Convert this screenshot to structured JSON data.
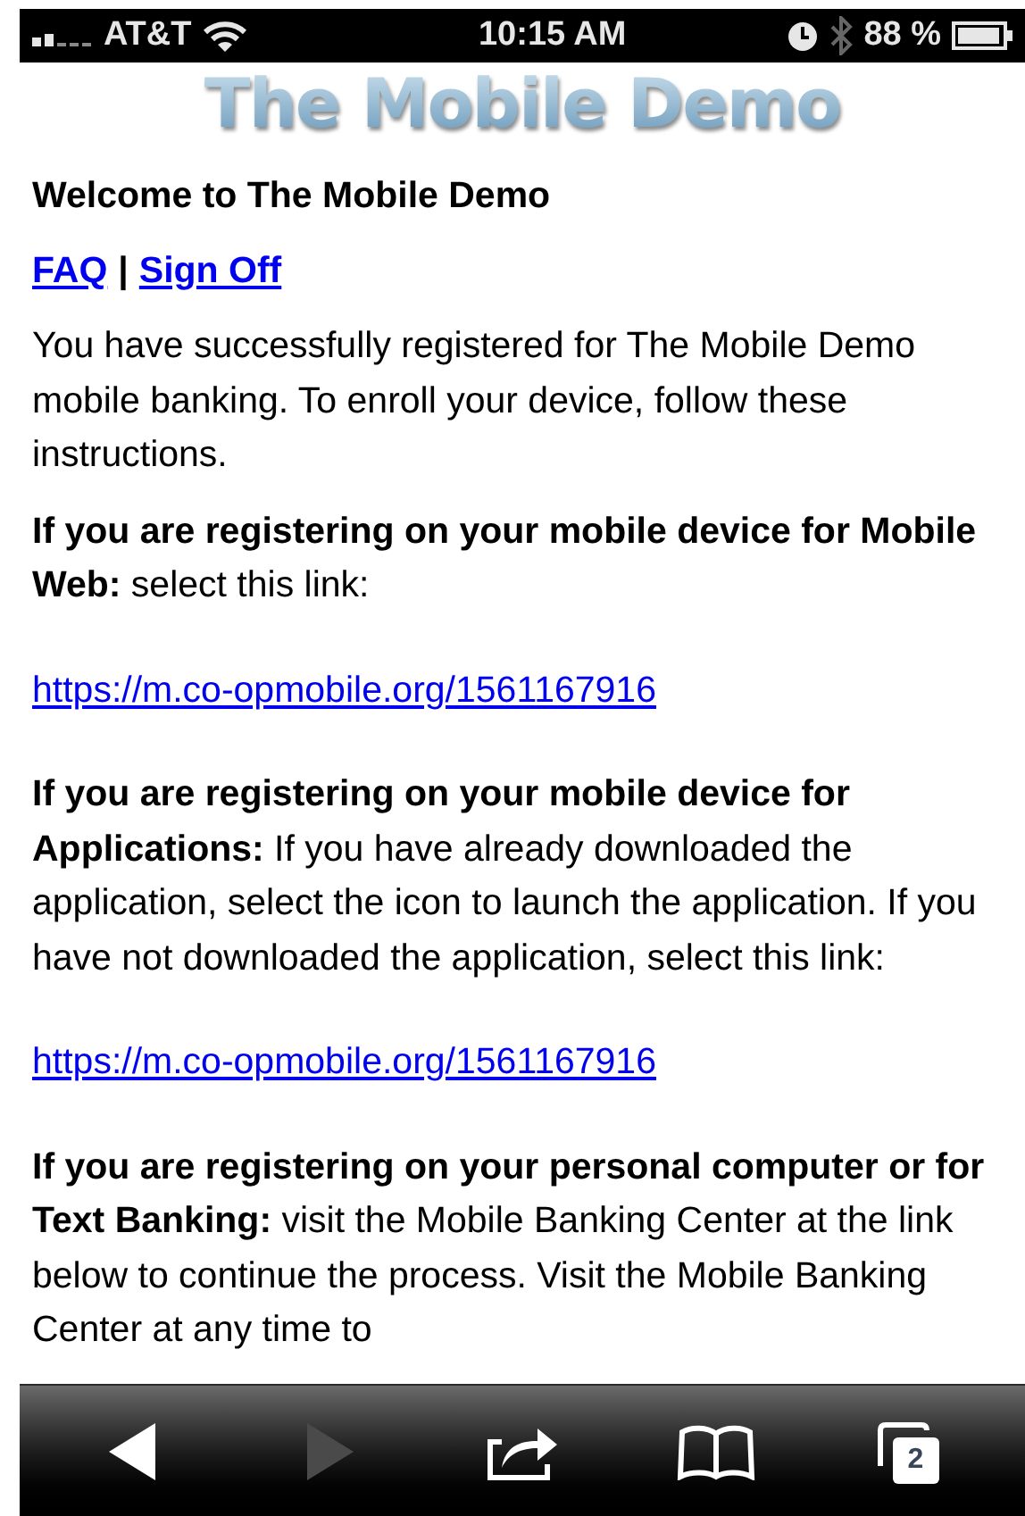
{
  "status_bar": {
    "carrier": "AT&T",
    "time": "10:15 AM",
    "battery": "88 %"
  },
  "logo": "The Mobile Demo",
  "heading": "Welcome to The Mobile Demo",
  "nav_links": [
    {
      "label": "FAQ"
    },
    {
      "label": "Sign Off"
    }
  ],
  "nav_separator": "|",
  "paragraphs": [
    {
      "kind": "text",
      "text": "You have successfully registered for The Mobile Demo mobile banking. To enroll your device, follow these instructions."
    },
    {
      "kind": "text",
      "text": "**If you are registering on your mobile device for Mobile Web:**  select this link:"
    },
    {
      "kind": "link",
      "text": "https://m.co-opmobile.org/1561167916"
    },
    {
      "kind": "text",
      "text": "**If you are registering on your mobile device for Applications:**  If you have already downloaded the application, select the icon to launch the application. If you have not downloaded the application, select this link:"
    },
    {
      "kind": "link",
      "text": "https://m.co-opmobile.org/1561167916"
    },
    {
      "kind": "text",
      "text": "**If you are registering on your personal computer or for Text Banking:**  visit the Mobile Banking Center at the link below to continue the process. Visit the Mobile Banking Center at any time to"
    }
  ],
  "toolbar": [
    {
      "kind": "back",
      "disabled": false
    },
    {
      "kind": "forward",
      "disabled": true
    },
    {
      "kind": "share",
      "disabled": false
    },
    {
      "kind": "bookmarks",
      "disabled": false
    },
    {
      "kind": "tabs",
      "disabled": false,
      "count": "2"
    }
  ]
}
